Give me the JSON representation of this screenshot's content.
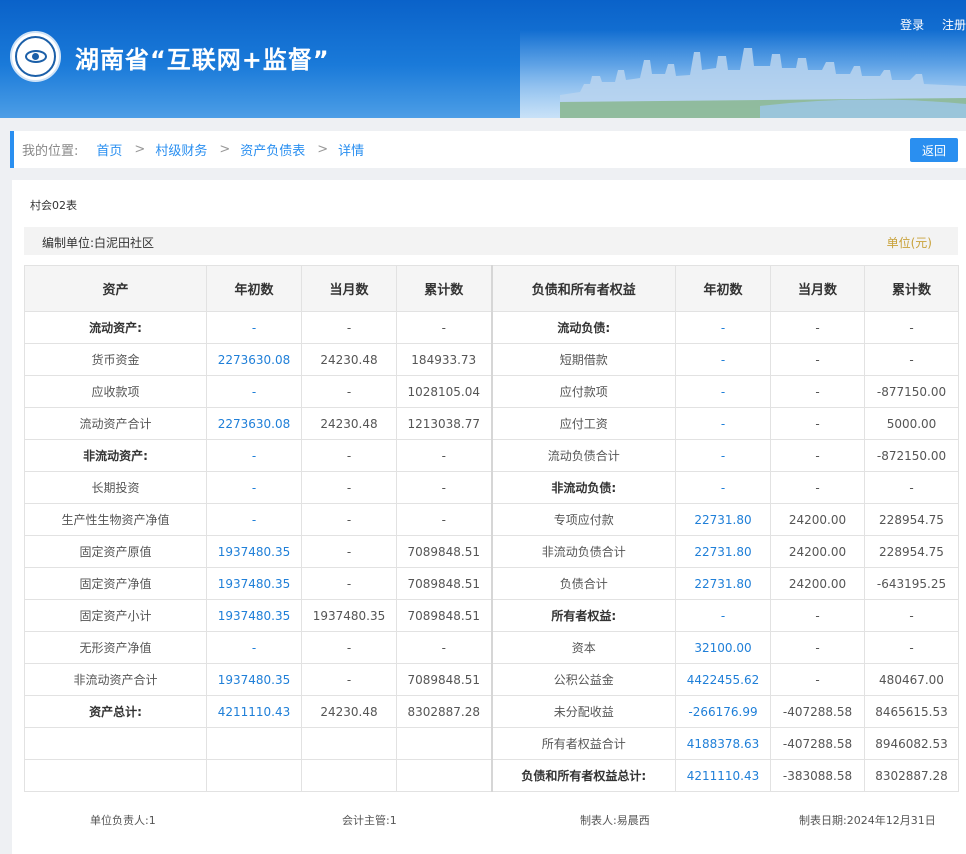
{
  "header": {
    "site_title": "湖南省“互联网+监督”",
    "login_label": "登录",
    "register_label": "注册"
  },
  "breadcrumb": {
    "prefix": "我的位置:",
    "items": [
      "首页",
      "村级财务",
      "资产负债表",
      "详情"
    ],
    "separator": ">",
    "back_label": "返回"
  },
  "report": {
    "form_code": "村会02表",
    "org_label": "编制单位:白泥田社区",
    "unit_label": "单位(元)",
    "columns": [
      "资产",
      "年初数",
      "当月数",
      "累计数",
      "负债和所有者权益",
      "年初数",
      "当月数",
      "累计数"
    ],
    "rows": [
      {
        "a": "流动资产:",
        "ab": true,
        "a1": "-",
        "a2": "-",
        "a3": "-",
        "l": "流动负债:",
        "lb": true,
        "l1": "-",
        "l2": "-",
        "l3": "-"
      },
      {
        "a": "货币资金",
        "a1": "2273630.08",
        "a2": "24230.48",
        "a3": "184933.73",
        "l": "短期借款",
        "l1": "-",
        "l2": "-",
        "l3": "-"
      },
      {
        "a": "应收款项",
        "a1": "-",
        "a2": "-",
        "a3": "1028105.04",
        "l": "应付款项",
        "l1": "-",
        "l2": "-",
        "l3": "-877150.00"
      },
      {
        "a": "流动资产合计",
        "a1": "2273630.08",
        "a2": "24230.48",
        "a3": "1213038.77",
        "l": "应付工资",
        "l1": "-",
        "l2": "-",
        "l3": "5000.00"
      },
      {
        "a": "非流动资产:",
        "ab": true,
        "a1": "-",
        "a2": "-",
        "a3": "-",
        "l": "流动负债合计",
        "l1": "-",
        "l2": "-",
        "l3": "-872150.00"
      },
      {
        "a": "长期投资",
        "a1": "-",
        "a2": "-",
        "a3": "-",
        "l": "非流动负债:",
        "lb": true,
        "l1": "-",
        "l2": "-",
        "l3": "-"
      },
      {
        "a": "生产性生物资产净值",
        "a1": "-",
        "a2": "-",
        "a3": "-",
        "l": "专项应付款",
        "l1": "22731.80",
        "l2": "24200.00",
        "l3": "228954.75"
      },
      {
        "a": "固定资产原值",
        "a1": "1937480.35",
        "a2": "-",
        "a3": "7089848.51",
        "l": "非流动负债合计",
        "l1": "22731.80",
        "l2": "24200.00",
        "l3": "228954.75"
      },
      {
        "a": "固定资产净值",
        "a1": "1937480.35",
        "a2": "-",
        "a3": "7089848.51",
        "l": "负债合计",
        "l1": "22731.80",
        "l2": "24200.00",
        "l3": "-643195.25"
      },
      {
        "a": "固定资产小计",
        "a1": "1937480.35",
        "a2": "1937480.35",
        "a3": "7089848.51",
        "l": "所有者权益:",
        "lb": true,
        "l1": "-",
        "l2": "-",
        "l3": "-"
      },
      {
        "a": "无形资产净值",
        "a1": "-",
        "a2": "-",
        "a3": "-",
        "l": "资本",
        "l1": "32100.00",
        "l2": "-",
        "l3": "-"
      },
      {
        "a": "非流动资产合计",
        "a1": "1937480.35",
        "a2": "-",
        "a3": "7089848.51",
        "l": "公积公益金",
        "l1": "4422455.62",
        "l2": "-",
        "l3": "480467.00"
      },
      {
        "a": "资产总计:",
        "ab": true,
        "a1": "4211110.43",
        "a2": "24230.48",
        "a3": "8302887.28",
        "l": "未分配收益",
        "l1": "-266176.99",
        "l2": "-407288.58",
        "l3": "8465615.53"
      },
      {
        "a": "",
        "a1": "",
        "a2": "",
        "a3": "",
        "l": "所有者权益合计",
        "l1": "4188378.63",
        "l2": "-407288.58",
        "l3": "8946082.53"
      },
      {
        "a": "",
        "a1": "",
        "a2": "",
        "a3": "",
        "l": "负债和所有者权益总计:",
        "lb": true,
        "l1": "4211110.43",
        "l2": "-383088.58",
        "l3": "8302887.28"
      }
    ],
    "footer": {
      "responsible": "单位负责人:1",
      "accountant": "会计主管:1",
      "preparer": "制表人:易晨西",
      "date": "制表日期:2024年12月31日"
    }
  }
}
